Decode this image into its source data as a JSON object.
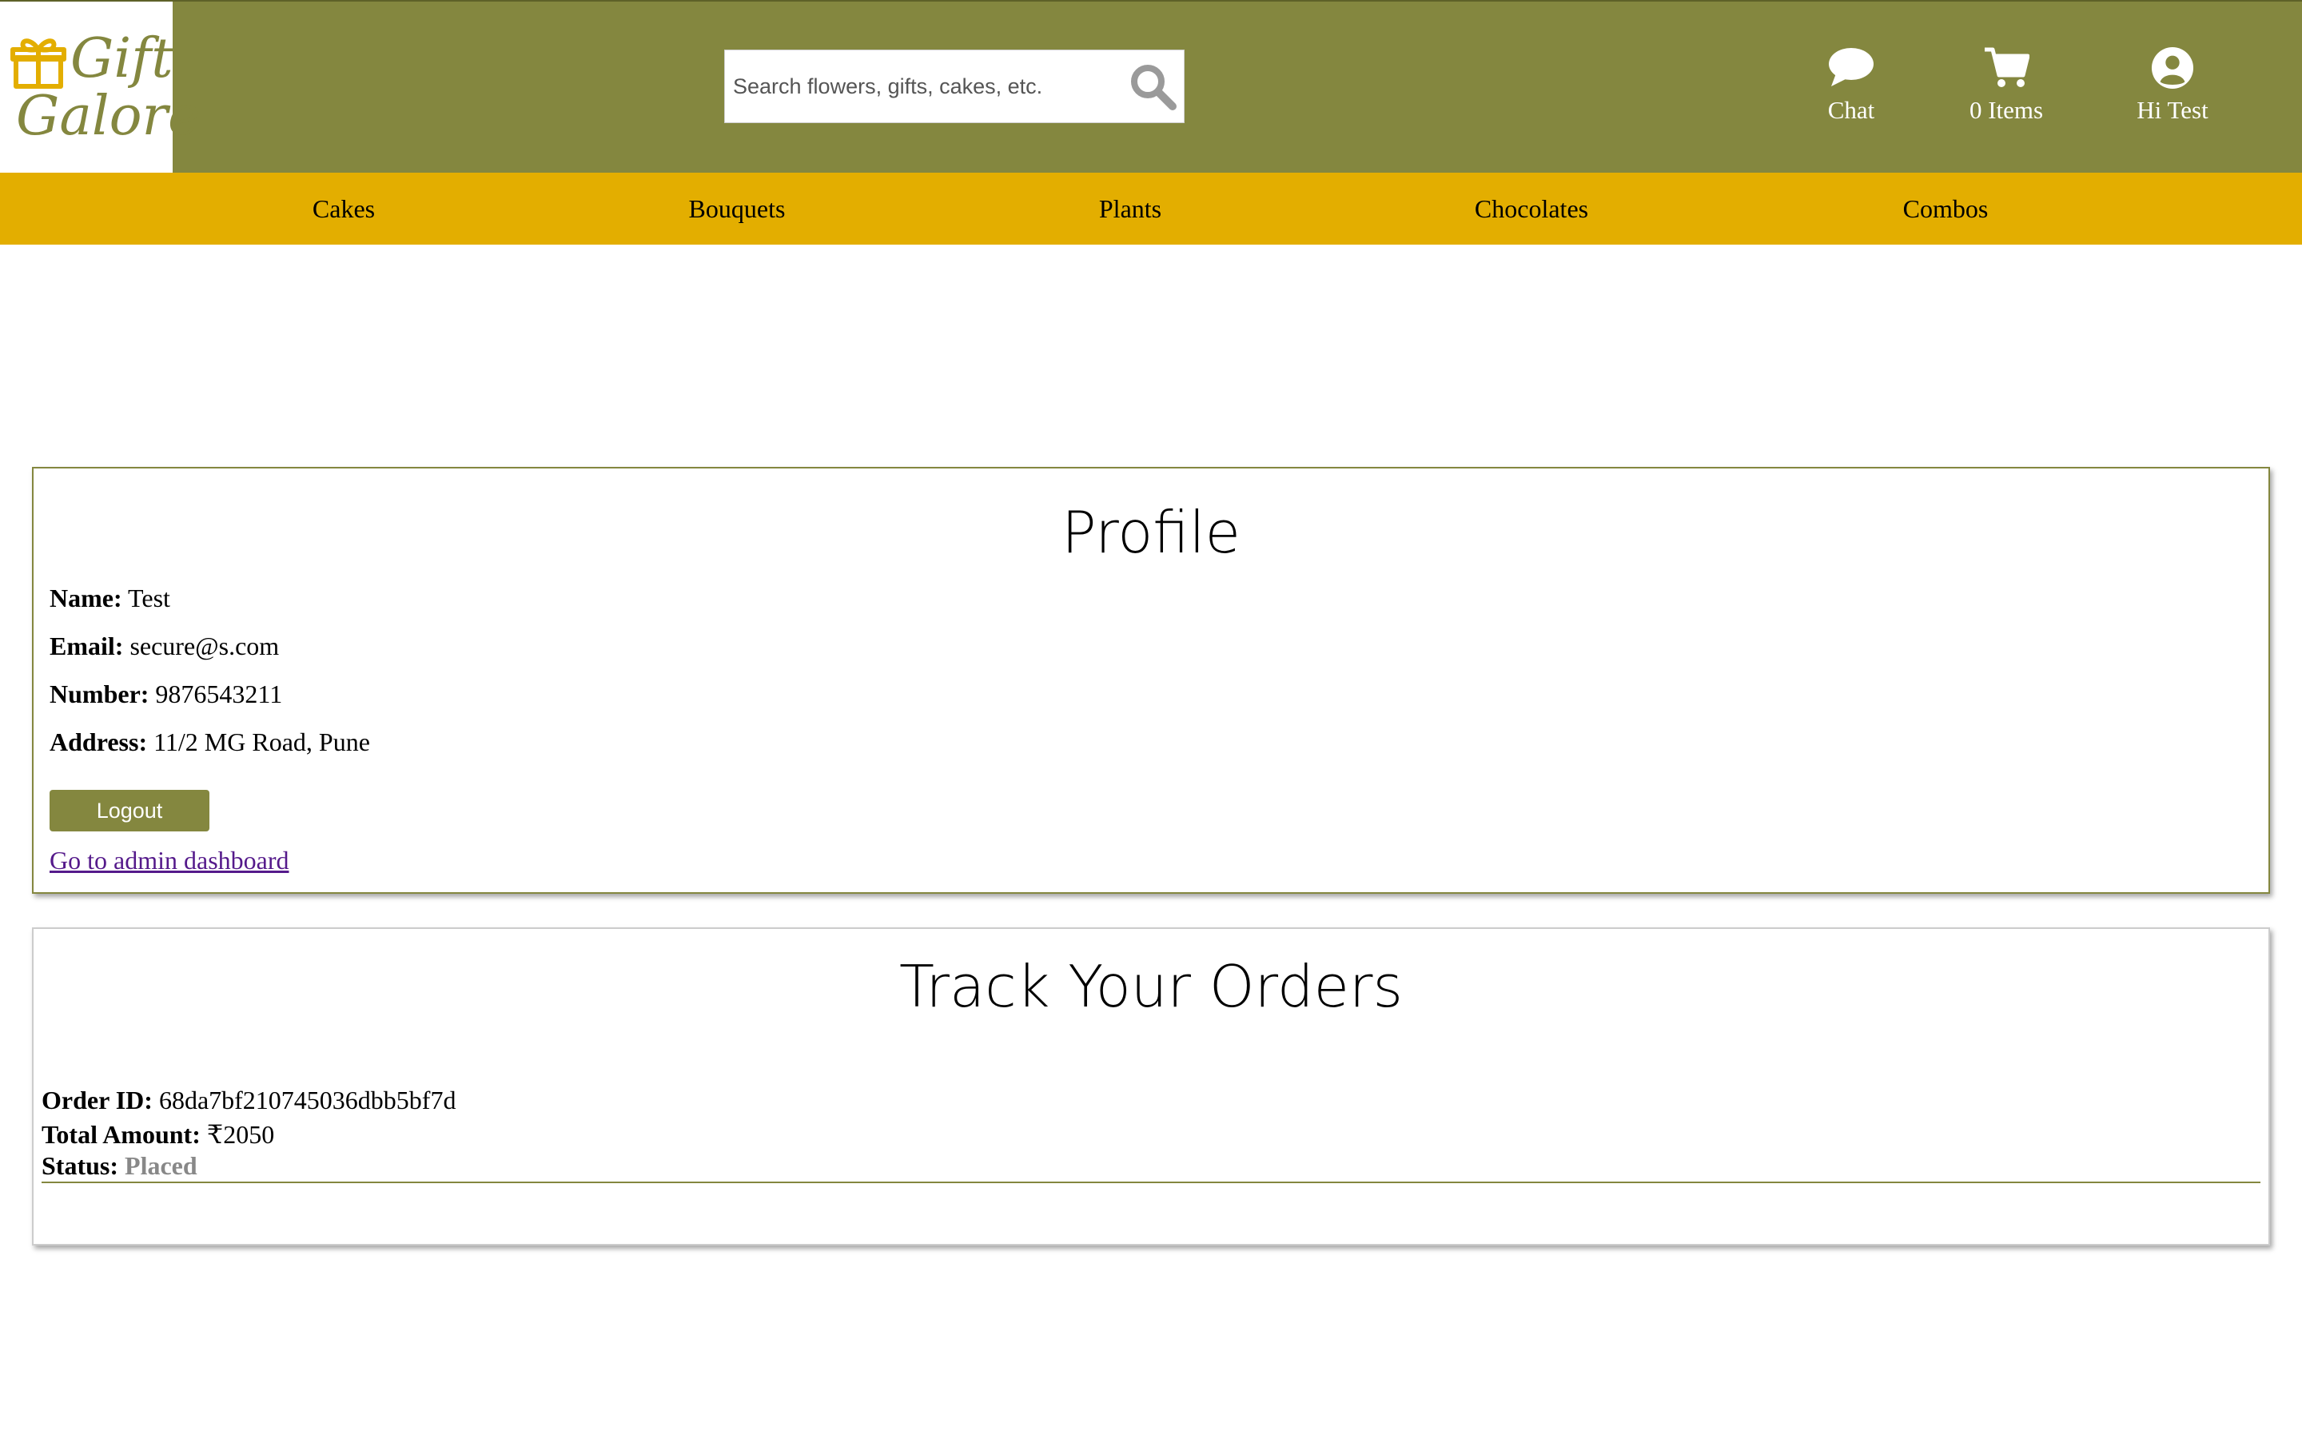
{
  "brand": {
    "line1": "Gift",
    "line2": "Galore",
    "color": "#84873f",
    "icon": "gift-icon",
    "icon_color": "#e3ae00"
  },
  "search": {
    "placeholder": "Search flowers, gifts, cakes, etc.",
    "icon": "search-icon"
  },
  "header_actions": [
    {
      "label": "Chat",
      "icon": "chat-bubble-icon"
    },
    {
      "label": "0 Items",
      "icon": "cart-icon"
    },
    {
      "label": "Hi Test",
      "icon": "user-circle-icon"
    }
  ],
  "nav": [
    "Cakes",
    "Bouquets",
    "Plants",
    "Chocolates",
    "Combos"
  ],
  "profile": {
    "title": "Profile",
    "fields": [
      {
        "label": "Name:",
        "value": "Test"
      },
      {
        "label": "Email:",
        "value": "secure@s.com"
      },
      {
        "label": "Number:",
        "value": "9876543211"
      },
      {
        "label": "Address:",
        "value": "11/2 MG Road, Pune"
      }
    ],
    "logout_label": "Logout",
    "admin_link": "Go to admin dashboard"
  },
  "orders": {
    "title": "Track Your Orders",
    "items": [
      {
        "id_label": "Order ID:",
        "id": "68da7bf210745036dbb5bf7d",
        "amount_label": "Total Amount:",
        "amount": "₹2050",
        "status_label": "Status:",
        "status": "Placed"
      }
    ]
  },
  "colors": {
    "header_bg": "#84873f",
    "nav_bg": "#e3ae00",
    "status_placed": "#888888",
    "link": "#551a8b"
  }
}
